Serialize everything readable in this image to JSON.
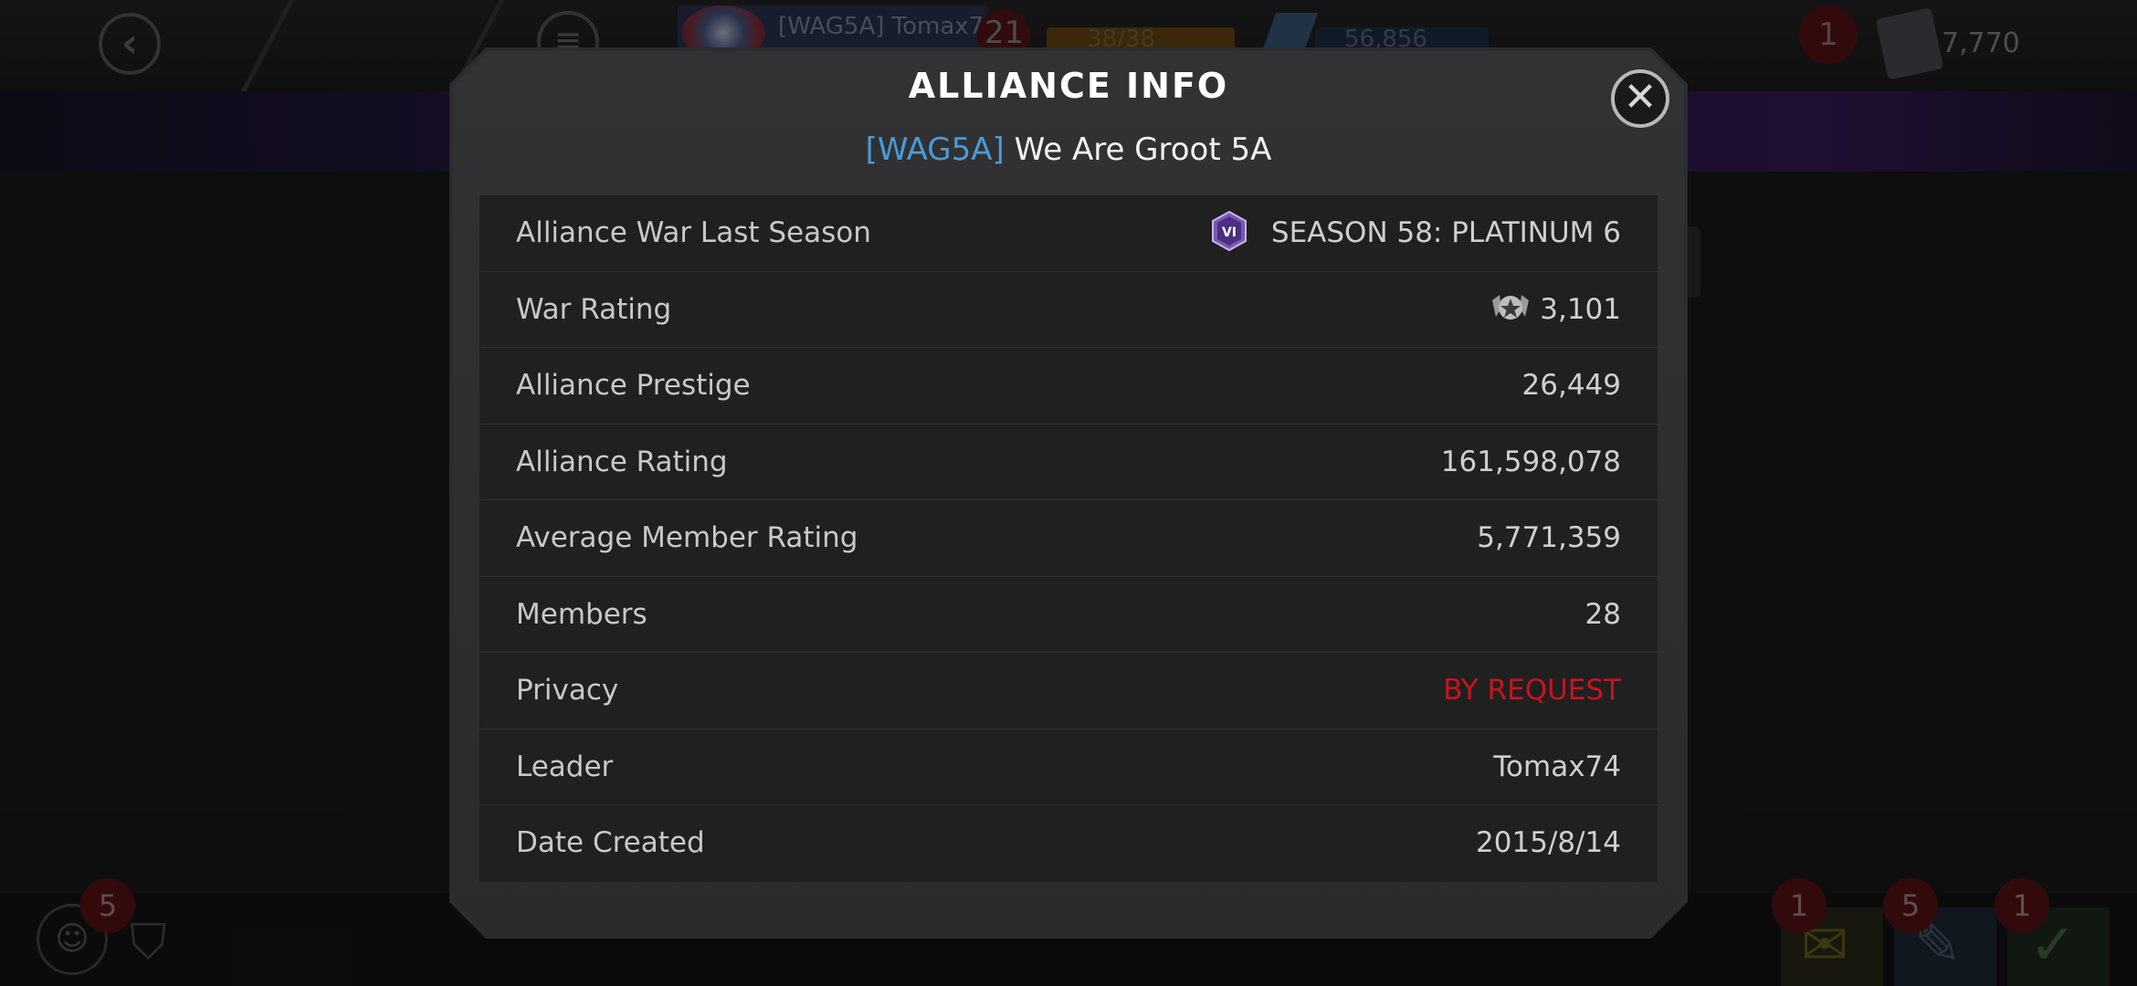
{
  "topbar": {
    "player_name": "[WAG5A] Tomax7",
    "player_level": "21",
    "gold": "38/38",
    "units": "56,856",
    "notification_count": "1",
    "crystal_count": "7,770"
  },
  "bottombar": {
    "alliance_badge": "5",
    "card_badges": [
      "1",
      "5",
      "1"
    ]
  },
  "modal": {
    "title": "ALLIANCE INFO",
    "alliance_tag": "[WAG5A]",
    "alliance_name": "We Are Groot 5A",
    "close_label": "✕"
  },
  "rows": [
    {
      "label": "Alliance War Last Season",
      "value": "SEASON 58: PLATINUM 6",
      "icon": "season-tier-icon",
      "icon_text": "VI"
    },
    {
      "label": "War Rating",
      "value": "3,101",
      "icon": "war-rating-star-icon"
    },
    {
      "label": "Alliance Prestige",
      "value": "26,449"
    },
    {
      "label": "Alliance Rating",
      "value": "161,598,078"
    },
    {
      "label": "Average Member Rating",
      "value": "5,771,359"
    },
    {
      "label": "Members",
      "value": "28"
    },
    {
      "label": "Privacy",
      "value": "BY REQUEST",
      "color": "#c8141b"
    },
    {
      "label": "Leader",
      "value": "Tomax74"
    },
    {
      "label": "Date Created",
      "value": "2015/8/14"
    }
  ],
  "colors": {
    "tag": "#4a9ad8",
    "privacy_red": "#c8141b",
    "modal_bg": "#2c2c2e",
    "table_bg": "#202021"
  }
}
